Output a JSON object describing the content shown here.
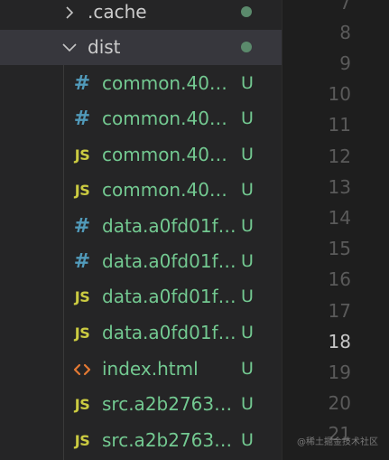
{
  "explorer": {
    "folders": [
      {
        "name": ".cache",
        "expanded": false,
        "decoration": "dot"
      },
      {
        "name": "dist",
        "expanded": true,
        "decoration": "dot"
      }
    ],
    "files": [
      {
        "icon": "css",
        "icon_glyph": "#",
        "name": "common.40…",
        "status": "U"
      },
      {
        "icon": "css",
        "icon_glyph": "#",
        "name": "common.40…",
        "status": "U"
      },
      {
        "icon": "js",
        "icon_glyph": "JS",
        "name": "common.40…",
        "status": "U"
      },
      {
        "icon": "js",
        "icon_glyph": "JS",
        "name": "common.40…",
        "status": "U"
      },
      {
        "icon": "css",
        "icon_glyph": "#",
        "name": "data.a0fd01f…",
        "status": "U"
      },
      {
        "icon": "css",
        "icon_glyph": "#",
        "name": "data.a0fd01f…",
        "status": "U"
      },
      {
        "icon": "js",
        "icon_glyph": "JS",
        "name": "data.a0fd01f…",
        "status": "U"
      },
      {
        "icon": "js",
        "icon_glyph": "JS",
        "name": "data.a0fd01f…",
        "status": "U"
      },
      {
        "icon": "html",
        "icon_glyph": "<>",
        "name": "index.html",
        "status": "U"
      },
      {
        "icon": "js",
        "icon_glyph": "JS",
        "name": "src.a2b2763…",
        "status": "U"
      },
      {
        "icon": "js",
        "icon_glyph": "JS",
        "name": "src.a2b2763…",
        "status": "U"
      }
    ]
  },
  "editor": {
    "line_numbers": [
      "7",
      "8",
      "9",
      "10",
      "11",
      "12",
      "13",
      "14",
      "15",
      "16",
      "17",
      "18",
      "19",
      "20",
      "21"
    ],
    "active_line": "18"
  },
  "watermark": "@稀土掘金技术社区",
  "colors": {
    "untracked_green": "#73c991",
    "css_icon": "#519aba",
    "js_icon": "#cbcb41",
    "html_icon": "#e37933",
    "selected_row": "#37373d"
  }
}
